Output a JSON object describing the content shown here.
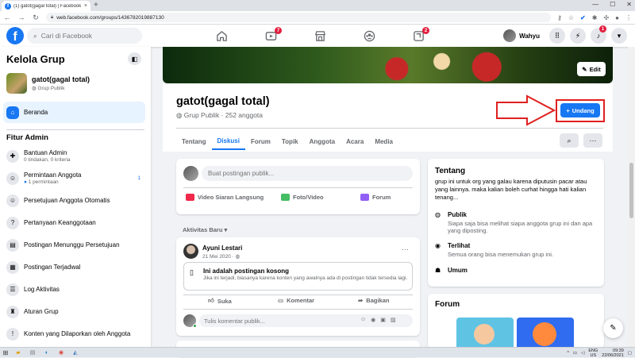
{
  "browser": {
    "tab_title": "(1) gatot(gagal total) | Facebook",
    "tab_icon": "f",
    "url": "web.facebook.com/groups/1436782019887130",
    "new_tab": "+",
    "close": "×",
    "minimize": "—",
    "maximize": "☐",
    "window_close": "✕"
  },
  "header": {
    "logo": "f",
    "search_placeholder": "Cari di Facebook",
    "nav": [
      {
        "name": "home",
        "badge": ""
      },
      {
        "name": "watch",
        "badge": "7"
      },
      {
        "name": "marketplace",
        "badge": ""
      },
      {
        "name": "groups",
        "badge": ""
      },
      {
        "name": "gaming",
        "badge": "2"
      }
    ],
    "user_name": "Wahyu",
    "notifications_badge": "1"
  },
  "sidebar": {
    "title": "Kelola Grup",
    "group": {
      "name": "gatot(gagal total)",
      "privacy": "Grup Publik"
    },
    "home_item": "Beranda",
    "section": "Fitur Admin",
    "items": [
      {
        "label": "Bantuan Admin",
        "sub": "0 tindakan, 0 kriteria",
        "icon": "✚"
      },
      {
        "label": "Permintaan Anggota",
        "sub": "1 permintaan",
        "count": "1",
        "icon": "☺"
      },
      {
        "label": "Persetujuan Anggota Otomatis",
        "sub": "",
        "icon": "☺"
      },
      {
        "label": "Pertanyaan Keanggotaan",
        "sub": "",
        "icon": "?"
      },
      {
        "label": "Postingan Menunggu Persetujuan",
        "sub": "",
        "icon": "▤"
      },
      {
        "label": "Postingan Terjadwal",
        "sub": "",
        "icon": "▦"
      },
      {
        "label": "Log Aktivitas",
        "sub": "",
        "icon": "☰"
      },
      {
        "label": "Aturan Grup",
        "sub": "",
        "icon": "♜"
      },
      {
        "label": "Konten yang Dilaporkan oleh Anggota",
        "sub": "",
        "icon": "!"
      }
    ]
  },
  "group": {
    "edit_label": "Edit",
    "title": "gatot(gagal total)",
    "subtitle": "Grup Publik · 252 anggota",
    "invite_label": "Undang",
    "tabs": [
      "Tentang",
      "Diskusi",
      "Forum",
      "Topik",
      "Anggota",
      "Acara",
      "Media"
    ],
    "active_tab": "Diskusi"
  },
  "composer": {
    "placeholder": "Buat postingan publik...",
    "actions": [
      {
        "label": "Video Siaran Langsung",
        "color": "#f02849"
      },
      {
        "label": "Foto/Video",
        "color": "#45bd62"
      },
      {
        "label": "Forum",
        "color": "#9360f7"
      }
    ]
  },
  "feed": {
    "heading": "Aktivitas Baru",
    "post": {
      "author": "Ayuni Lestari",
      "date": "21 Mei 2020 ·",
      "empty_title": "Ini adalah postingan kosong",
      "empty_desc": "Jika ini terjadi, biasanya karena konten yang awalnya ada di postingan tidak tersedia lagi.",
      "like": "Suka",
      "comment": "Komentar",
      "share": "Bagikan",
      "comment_placeholder": "Tulis komentar publik..."
    }
  },
  "about": {
    "title": "Tentang",
    "description": "grup ini untuk org yang galau karena diputusin pacar atau yang lainnya. maka kalian boleh curhat hingga hati kalian tenang...",
    "public_title": "Publik",
    "public_desc": "Siapa saja bisa melihat siapa anggota grup ini dan apa yang diposting.",
    "visible_title": "Terlihat",
    "visible_desc": "Semua orang bisa menemukan grup ini.",
    "general_title": "Umum"
  },
  "forum": {
    "title": "Forum"
  },
  "taskbar": {
    "lang": "ENG",
    "region": "US",
    "time": "09:39",
    "date": "22/06/2021"
  },
  "colors": {
    "accent": "#1877f2",
    "highlight": "#e0201f"
  }
}
